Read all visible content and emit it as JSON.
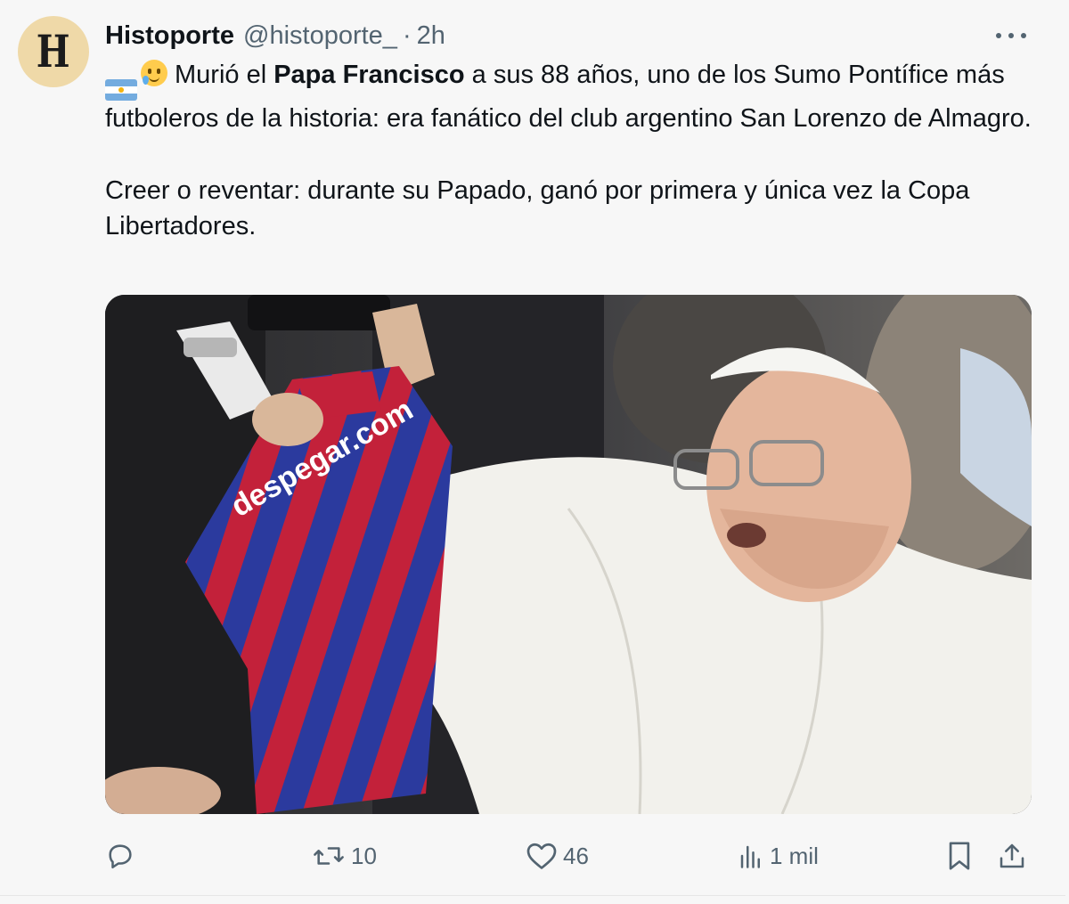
{
  "tweet": {
    "avatar_letter": "H",
    "author_name": "Histoporte",
    "handle": "@histoporte_",
    "separator": "·",
    "time": "2h",
    "text": {
      "p1_before": "Murió el ",
      "p1_bold": "Papa Francisco",
      "p1_after": " a sus 88 años, uno de los Sumo Pontífice más futboleros de la historia: era fanático del club argentino San Lorenzo de Almagro.",
      "p2": "Creer o reventar: durante su Papado, ganó por primera y única vez la Copa Libertadores."
    },
    "emojis": [
      "argentina-flag-icon",
      "crying-face-icon"
    ]
  },
  "actions": {
    "reply": {
      "icon": "reply-icon",
      "count": ""
    },
    "retweet": {
      "icon": "retweet-icon",
      "count": "10"
    },
    "like": {
      "icon": "heart-icon",
      "count": "46"
    },
    "views": {
      "icon": "views-icon",
      "count": "1 mil"
    },
    "bookmark": {
      "icon": "bookmark-icon"
    },
    "share": {
      "icon": "share-icon"
    }
  },
  "colors": {
    "background": "#f7f7f7",
    "text": "#0f1419",
    "secondary": "#536471",
    "jersey_blue": "#2b3a9e",
    "jersey_red": "#c3213a"
  }
}
